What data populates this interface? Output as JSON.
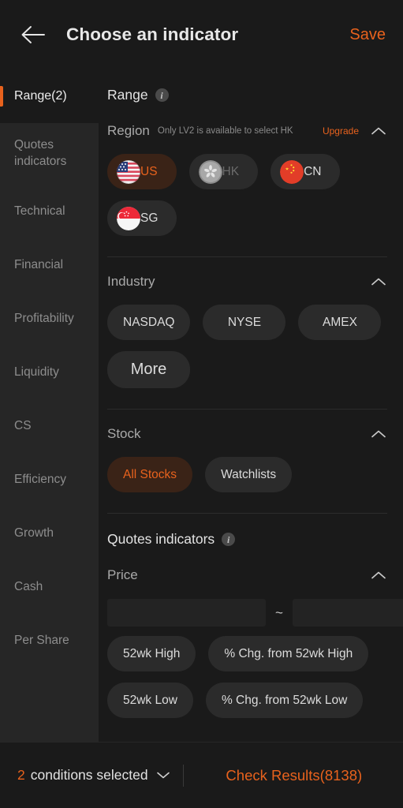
{
  "header": {
    "back_icon": "arrow-left-icon",
    "title": "Choose an indicator",
    "save_label": "Save"
  },
  "sidebar": {
    "items": [
      {
        "label": "Range(2)",
        "active": true
      },
      {
        "label": "Quotes indicators",
        "active": false
      },
      {
        "label": "Technical",
        "active": false
      },
      {
        "label": "Financial",
        "active": false
      },
      {
        "label": "Profitability",
        "active": false
      },
      {
        "label": "Liquidity",
        "active": false
      },
      {
        "label": "CS",
        "active": false
      },
      {
        "label": "Efficiency",
        "active": false
      },
      {
        "label": "Growth",
        "active": false
      },
      {
        "label": "Cash",
        "active": false
      },
      {
        "label": "Per Share",
        "active": false
      }
    ]
  },
  "content": {
    "range_section": {
      "title": "Range",
      "info_icon": "info-icon",
      "groups": [
        {
          "label": "Region",
          "note": "Only LV2 is available to select HK",
          "upgrade_label": "Upgrade",
          "collapse_icon": "chevron-up-icon",
          "chips": [
            {
              "label": "US",
              "flag": "us-flag",
              "state": "selected"
            },
            {
              "label": "HK",
              "flag": "hk-flag",
              "state": "disabled"
            },
            {
              "label": "CN",
              "flag": "cn-flag",
              "state": "normal"
            },
            {
              "label": "SG",
              "flag": "sg-flag",
              "state": "normal"
            }
          ]
        },
        {
          "label": "Industry",
          "note": "",
          "upgrade_label": "",
          "collapse_icon": "chevron-up-icon",
          "chips": [
            {
              "label": "NASDAQ",
              "state": "normal"
            },
            {
              "label": "NYSE",
              "state": "normal"
            },
            {
              "label": "AMEX",
              "state": "normal"
            },
            {
              "label": "More",
              "state": "normal",
              "big": true
            }
          ]
        },
        {
          "label": "Stock",
          "note": "",
          "upgrade_label": "",
          "collapse_icon": "chevron-up-icon",
          "chips": [
            {
              "label": "All Stocks",
              "state": "selected"
            },
            {
              "label": "Watchlists",
              "state": "normal"
            }
          ]
        }
      ]
    },
    "quotes_section": {
      "title": "Quotes indicators",
      "info_icon": "info-icon",
      "price_group": {
        "label": "Price",
        "collapse_icon": "chevron-up-icon",
        "min_value": "",
        "min_placeholder": "",
        "separator": "~",
        "max_value": "",
        "max_placeholder": ""
      },
      "chips": [
        {
          "label": "52wk High"
        },
        {
          "label": "% Chg. from 52wk High"
        },
        {
          "label": "52wk Low"
        },
        {
          "label": "% Chg. from 52wk Low"
        }
      ]
    }
  },
  "bottom_bar": {
    "condition_count": "2",
    "condition_text": "conditions selected",
    "expand_icon": "chevron-down-icon",
    "check_results_label": "Check Results(8138)"
  },
  "colors": {
    "accent": "#e8621d",
    "page_bg": "#1a1a1a",
    "sidebar_bg": "#262626",
    "chip_bg": "#2b2b2b",
    "chip_selected_bg": "#3a2317",
    "text_primary": "#e3e3e3",
    "text_muted": "#8d8d8d"
  }
}
